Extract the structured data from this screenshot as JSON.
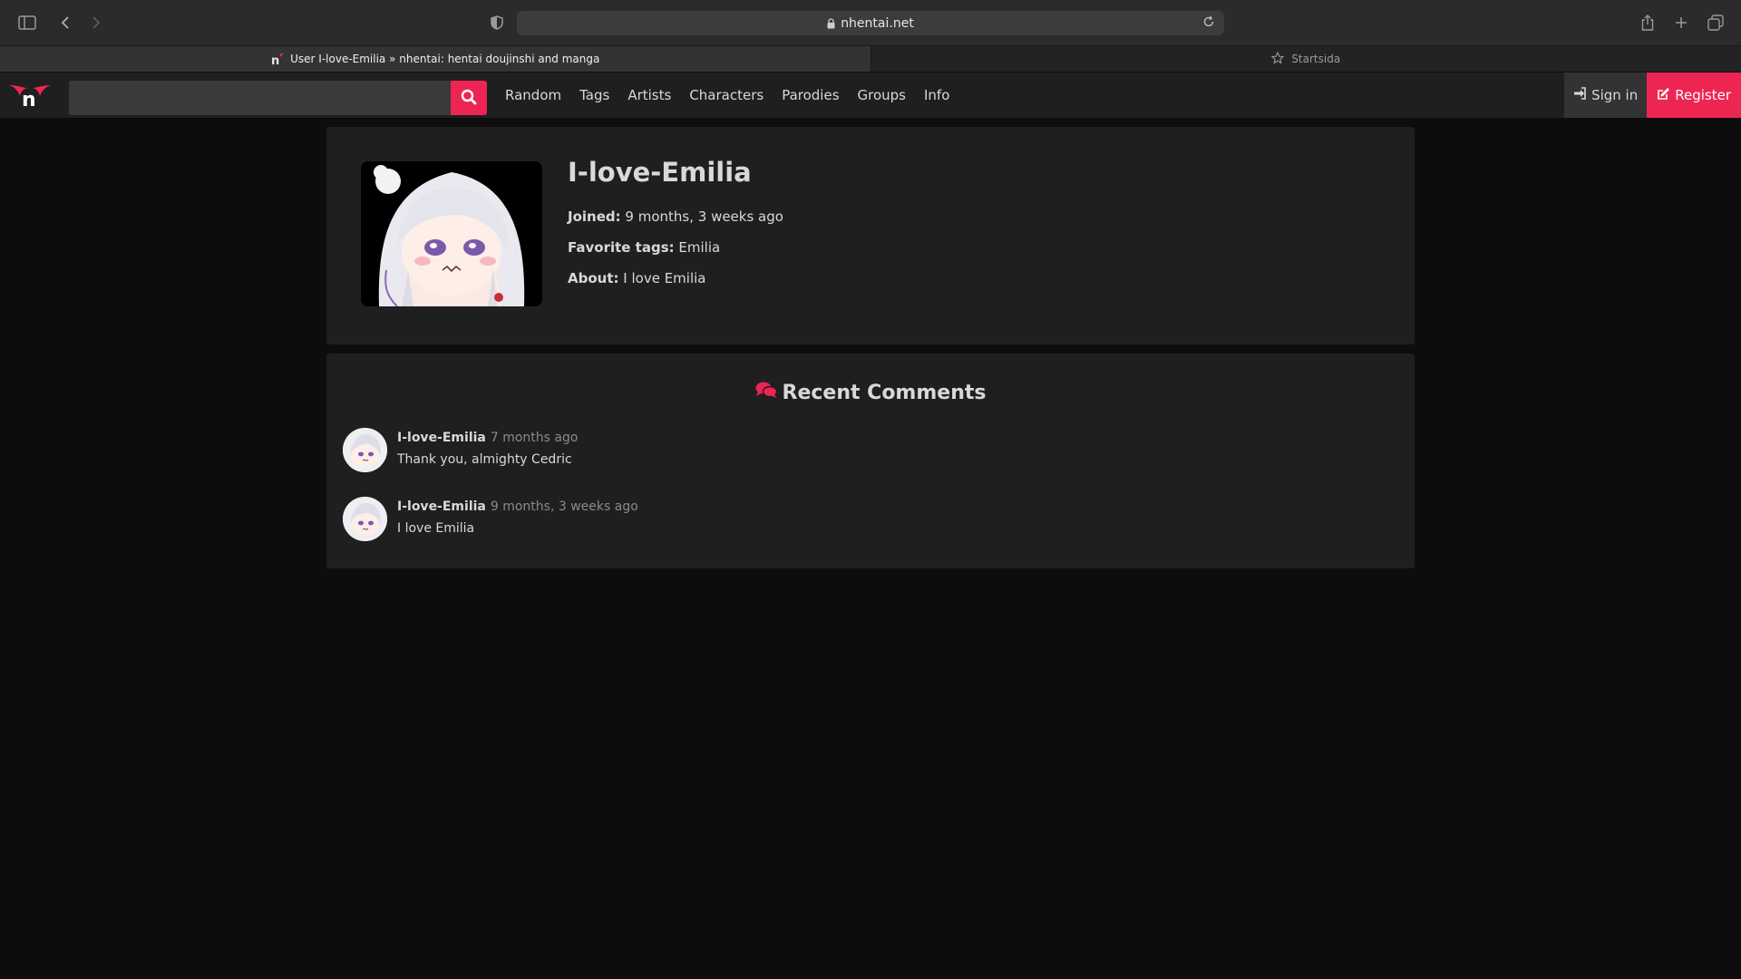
{
  "browser": {
    "url": "nhentai.net",
    "tabs": [
      {
        "title": "User I-love-Emilia » nhentai: hentai doujinshi and manga",
        "active": true
      },
      {
        "title": "Startsida",
        "active": false
      }
    ]
  },
  "nav": {
    "search_placeholder": "",
    "menu": [
      "Random",
      "Tags",
      "Artists",
      "Characters",
      "Parodies",
      "Groups",
      "Info"
    ],
    "signin_label": "Sign in",
    "register_label": "Register",
    "accent": "#ed2553"
  },
  "profile": {
    "username": "I-love-Emilia",
    "joined_label": "Joined:",
    "joined_value": "9 months, 3 weeks ago",
    "fav_label": "Favorite tags:",
    "fav_value": "Emilia",
    "about_label": "About:",
    "about_value": "I love Emilia"
  },
  "comments": {
    "title": "Recent Comments",
    "items": [
      {
        "user": "I-love-Emilia",
        "time": "7 months ago",
        "text": "Thank you, almighty Cedric"
      },
      {
        "user": "I-love-Emilia",
        "time": "9 months, 3 weeks ago",
        "text": "I love Emilia"
      }
    ]
  }
}
